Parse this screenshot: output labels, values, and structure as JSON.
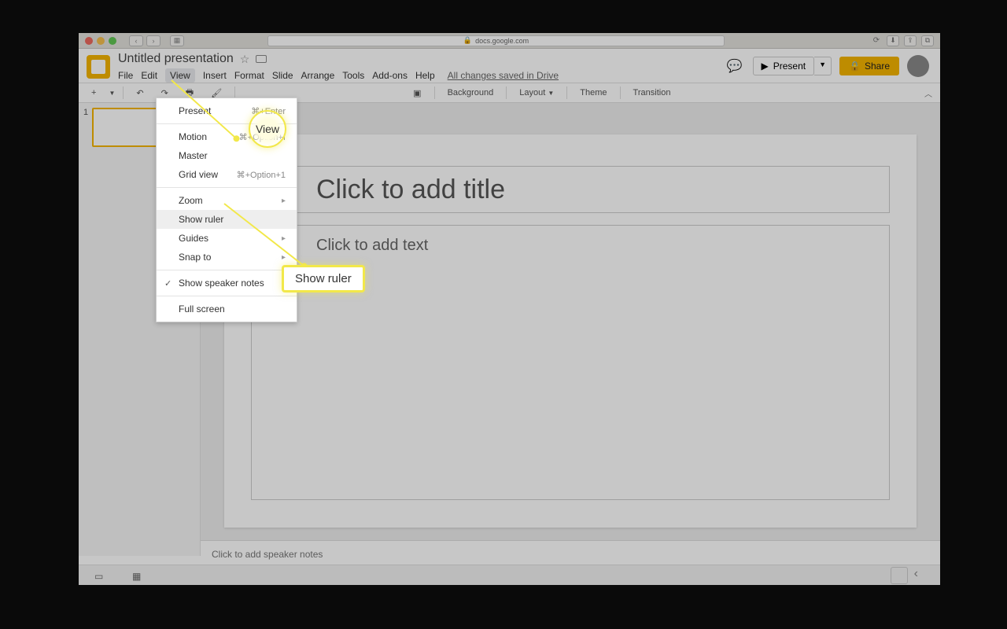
{
  "browser": {
    "url": "docs.google.com"
  },
  "app": {
    "title": "Untitled presentation",
    "menus": [
      "File",
      "Edit",
      "View",
      "Insert",
      "Format",
      "Slide",
      "Arrange",
      "Tools",
      "Add-ons",
      "Help"
    ],
    "active_menu_index": 2,
    "saved_status": "All changes saved in Drive",
    "present_label": "Present",
    "share_label": "Share"
  },
  "toolbar": {
    "arrow_label": "▼",
    "background_label": "Background",
    "layout_label": "Layout",
    "theme_label": "Theme",
    "transition_label": "Transition"
  },
  "dropdown": {
    "items": [
      {
        "label": "Present",
        "shortcut": "⌘+Enter"
      },
      {
        "sep": true
      },
      {
        "label": "Motion",
        "shortcut": "⌘+Option+I"
      },
      {
        "label": "Master"
      },
      {
        "label": "Grid view",
        "shortcut": "⌘+Option+1"
      },
      {
        "sep": true
      },
      {
        "label": "Zoom",
        "submenu": true
      },
      {
        "label": "Show ruler",
        "hover": true
      },
      {
        "label": "Guides",
        "submenu": true
      },
      {
        "label": "Snap to",
        "submenu": true
      },
      {
        "sep": true
      },
      {
        "label": "Show speaker notes",
        "checked": true
      },
      {
        "sep": true
      },
      {
        "label": "Full screen"
      }
    ]
  },
  "slide": {
    "number": "1",
    "title_placeholder": "Click to add title",
    "body_placeholder": "Click to add text",
    "notes_placeholder": "Click to add speaker notes"
  },
  "callouts": {
    "view_label": "View",
    "ruler_label": "Show ruler"
  }
}
